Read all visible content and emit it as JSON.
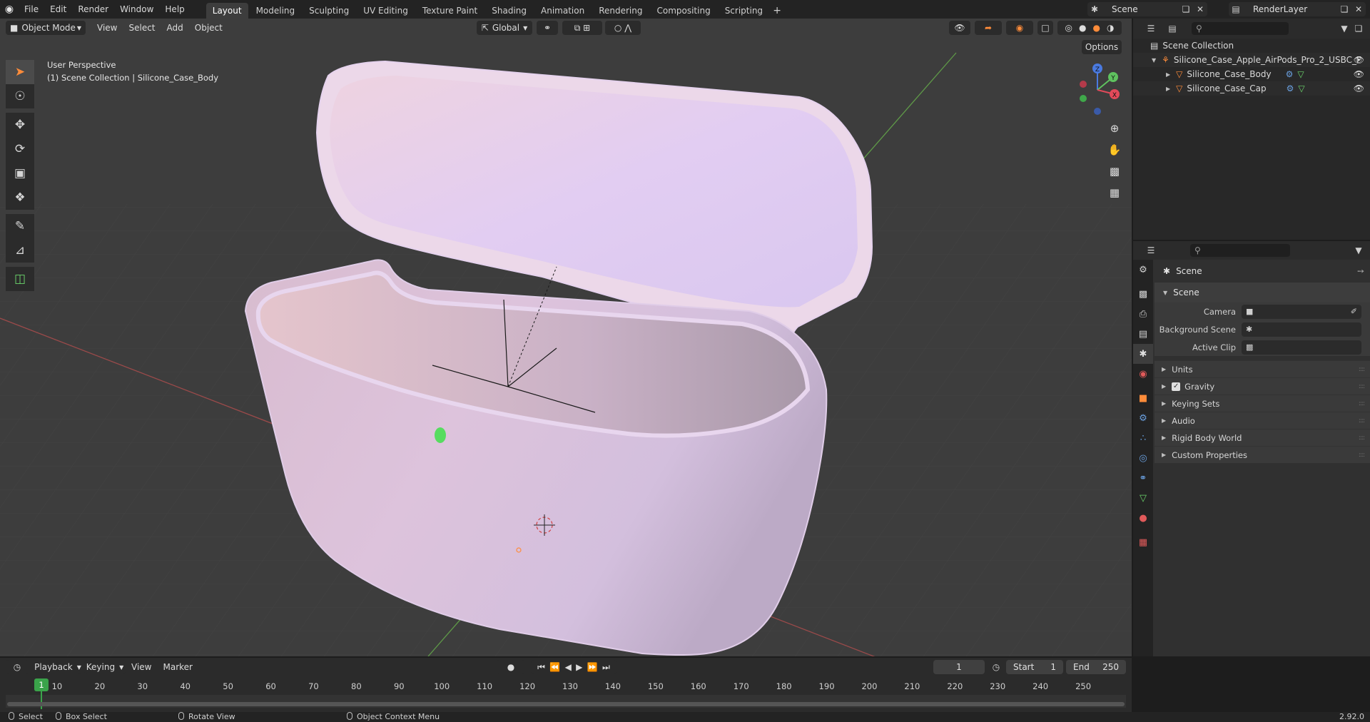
{
  "topbar": {
    "menus": [
      "File",
      "Edit",
      "Render",
      "Window",
      "Help"
    ],
    "workspaces": [
      "Layout",
      "Modeling",
      "Sculpting",
      "UV Editing",
      "Texture Paint",
      "Shading",
      "Animation",
      "Rendering",
      "Compositing",
      "Scripting"
    ],
    "active_workspace": "Layout",
    "scene_name": "Scene",
    "view_layer": "RenderLayer"
  },
  "viewport": {
    "mode": "Object Mode",
    "menus": [
      "View",
      "Select",
      "Add",
      "Object"
    ],
    "orientation": "Global",
    "options_label": "Options",
    "view_name": "User Perspective",
    "context": "(1) Scene Collection | Silicone_Case_Body",
    "gizmo_axes": [
      "Z",
      "Y",
      "X"
    ]
  },
  "outliner": {
    "root": "Scene Collection",
    "collection": "Silicone_Case_Apple_AirPods_Pro_2_USBC_F",
    "objects": [
      "Silicone_Case_Body",
      "Silicone_Case_Cap"
    ]
  },
  "properties": {
    "context_name": "Scene",
    "panel_title": "Scene",
    "fields": {
      "camera": "Camera",
      "background_scene": "Background Scene",
      "active_clip": "Active Clip"
    },
    "subpanels": [
      "Units",
      "Gravity",
      "Keying Sets",
      "Audio",
      "Rigid Body World",
      "Custom Properties"
    ],
    "gravity_checked": true
  },
  "timeline": {
    "menus": [
      "Playback",
      "Keying",
      "View",
      "Marker"
    ],
    "current_frame": "1",
    "start_label": "Start",
    "start_value": "1",
    "end_label": "End",
    "end_value": "250",
    "ruler_labels": [
      "1",
      "10",
      "20",
      "30",
      "40",
      "50",
      "60",
      "70",
      "80",
      "90",
      "100",
      "110",
      "120",
      "130",
      "140",
      "150",
      "160",
      "170",
      "180",
      "190",
      "200",
      "210",
      "220",
      "230",
      "240",
      "250"
    ]
  },
  "statusbar": {
    "select": "Select",
    "box_select": "Box Select",
    "rotate_view": "Rotate View",
    "context_menu": "Object Context Menu",
    "version": "2.92.0"
  },
  "colors": {
    "accent_orange": "#ff8c3a",
    "frame_green": "#3aa34a",
    "case_pink": "#e9d2e4",
    "case_lavender": "#dccaf0"
  }
}
